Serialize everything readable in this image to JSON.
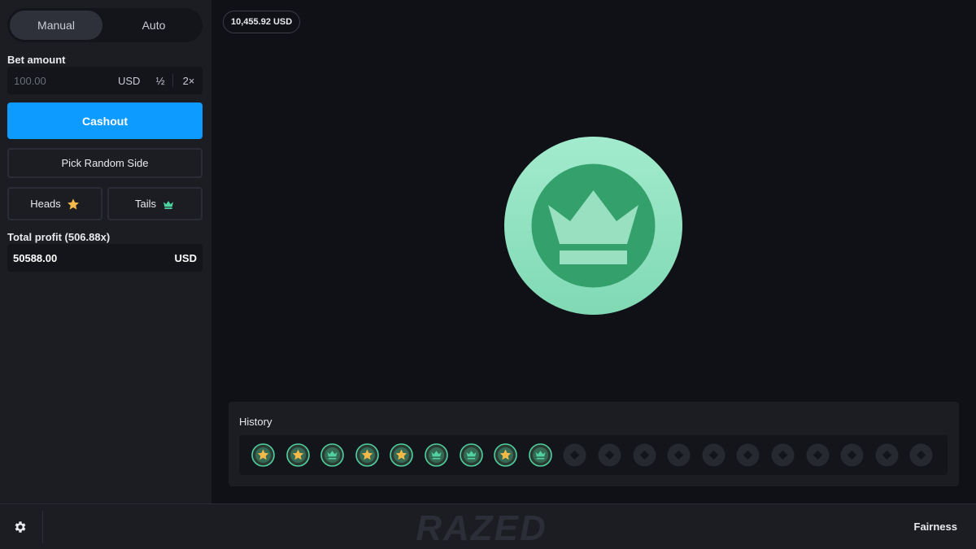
{
  "mode_tabs": {
    "manual": "Manual",
    "auto": "Auto"
  },
  "bet": {
    "label": "Bet amount",
    "placeholder": "100.00",
    "currency": "USD",
    "half_label": "½",
    "double_label": "2×"
  },
  "cashout_label": "Cashout",
  "random_label": "Pick Random Side",
  "sides": {
    "heads": "Heads",
    "tails": "Tails"
  },
  "profit": {
    "label": "Total profit (506.88x)",
    "value": "50588.00",
    "currency": "USD"
  },
  "balance": "10,455.92 USD",
  "current_result": "tails",
  "history": {
    "title": "History",
    "results": [
      "heads",
      "heads",
      "tails",
      "heads",
      "heads",
      "tails",
      "tails",
      "heads",
      "tails"
    ],
    "slots": 20
  },
  "footer": {
    "logo_text": "RAZED",
    "fairness_label": "Fairness"
  },
  "colors": {
    "accent": "#0d9bff",
    "heads": "#f5b94a",
    "tails": "#4fd1a0",
    "coin_light": "#8fe3c1",
    "coin_dark": "#34a06c"
  }
}
